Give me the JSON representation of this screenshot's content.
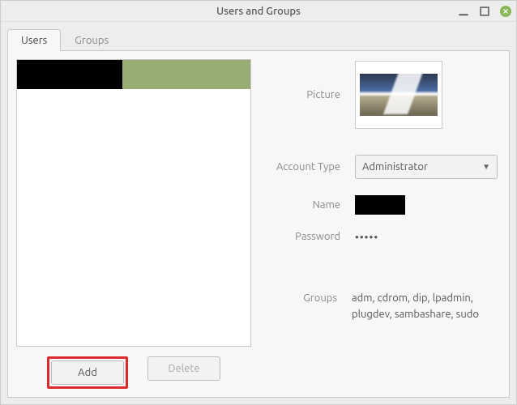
{
  "window": {
    "title": "Users and Groups"
  },
  "tabs": {
    "users": "Users",
    "groups": "Groups"
  },
  "buttons": {
    "add": "Add",
    "delete": "Delete"
  },
  "fields": {
    "picture": "Picture",
    "account_type": "Account Type",
    "name": "Name",
    "password": "Password",
    "groups": "Groups"
  },
  "values": {
    "account_type": "Administrator",
    "password_mask": "●●●●●",
    "groups": "adm, cdrom, dip, lpadmin, plugdev, sambashare, sudo"
  }
}
